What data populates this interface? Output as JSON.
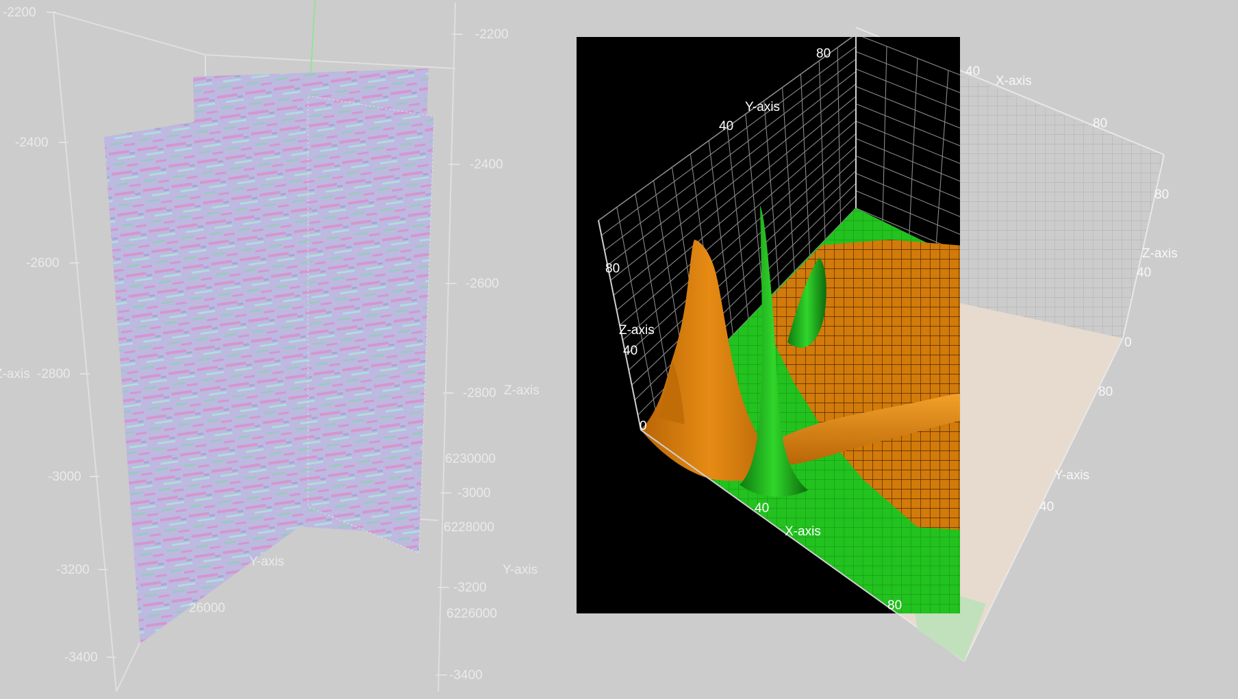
{
  "colors": {
    "background": "#cccccc",
    "surface_orange": "#d27a0a",
    "surface_green": "#22c21f",
    "slice_violet": "#a9a1ff",
    "slice_magenta": "#e04fd0",
    "slice_cyan": "#8ff3ee",
    "panel_black": "#000000"
  },
  "chart_data": [
    {
      "type": "heatmap",
      "description_kind": "3d-seismic-slices",
      "z_axis": {
        "label": "Z-axis",
        "ticks_left": [
          "-2200",
          "-2400",
          "-2600",
          "-2800",
          "-3000",
          "-3200",
          "-3400"
        ],
        "ticks_right": [
          "-2200",
          "-2400",
          "-2600",
          "-2800",
          "-3000",
          "-3200",
          "-3400"
        ]
      },
      "y_axis": {
        "label": "Y-axis",
        "ticks": [
          "6230000",
          "6228000",
          "6226000"
        ]
      },
      "x_axis": {
        "ticks": [
          "626000"
        ]
      },
      "left_z_label": "Z-axis",
      "bottom_y_label": "Y-axis",
      "partial_tick": "26000"
    },
    {
      "type": "area",
      "description_kind": "3d-surface",
      "x_axis": {
        "label": "X-axis",
        "ticks": [
          "40",
          "80"
        ]
      },
      "y_axis": {
        "label": "Y-axis",
        "ticks": [
          "40",
          "80"
        ]
      },
      "z_axis": {
        "label": "Z-axis",
        "ticks": [
          "40",
          "80"
        ]
      },
      "origin_label": "0",
      "ghost_axes": {
        "x_label": "X-axis",
        "x_ticks": [
          "40",
          "80"
        ],
        "y_label": "Y-axis",
        "y_ticks": [
          "40",
          "80"
        ],
        "z_label": "Z-axis",
        "z_ticks": [
          "40",
          "80"
        ],
        "zero": "0"
      }
    }
  ]
}
